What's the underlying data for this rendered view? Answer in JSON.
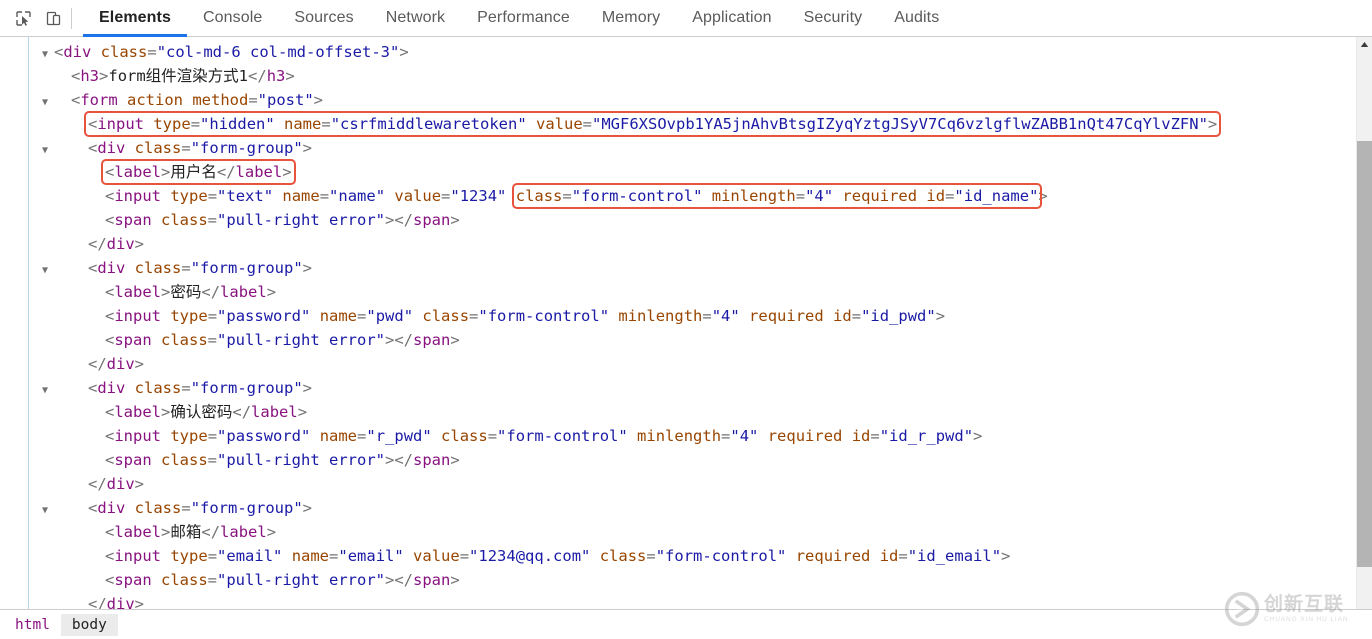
{
  "toolbar": {
    "icons": [
      {
        "name": "inspect-element-icon",
        "label": "Inspect element"
      },
      {
        "name": "device-toolbar-icon",
        "label": "Toggle device toolbar"
      }
    ],
    "tabs": [
      {
        "label": "Elements",
        "active": true
      },
      {
        "label": "Console",
        "active": false
      },
      {
        "label": "Sources",
        "active": false
      },
      {
        "label": "Network",
        "active": false
      },
      {
        "label": "Performance",
        "active": false
      },
      {
        "label": "Memory",
        "active": false
      },
      {
        "label": "Application",
        "active": false
      },
      {
        "label": "Security",
        "active": false
      },
      {
        "label": "Audits",
        "active": false
      }
    ],
    "accent_color": "#1a73e8"
  },
  "code": {
    "highlight_color": "#e8533b",
    "lines": [
      {
        "id": "line-div-col-md",
        "arrow": "▼",
        "indent": 0,
        "tokens": [
          {
            "t": "punc",
            "s": "<"
          },
          {
            "t": "tag",
            "s": "div"
          },
          {
            "t": "attr",
            "s": " class"
          },
          {
            "t": "punc",
            "s": "="
          },
          {
            "t": "val",
            "s": "\"col-md-6 col-md-offset-3\""
          },
          {
            "t": "punc",
            "s": ">"
          }
        ]
      },
      {
        "id": "line-h3",
        "arrow": "",
        "indent": 1,
        "tokens": [
          {
            "t": "punc",
            "s": "<"
          },
          {
            "t": "tag",
            "s": "h3"
          },
          {
            "t": "punc",
            "s": ">"
          },
          {
            "t": "text",
            "s": "form组件渲染方式1"
          },
          {
            "t": "punc",
            "s": "</"
          },
          {
            "t": "tag",
            "s": "h3"
          },
          {
            "t": "punc",
            "s": ">"
          }
        ]
      },
      {
        "id": "line-form",
        "arrow": "▼",
        "indent": 1,
        "tokens": [
          {
            "t": "punc",
            "s": "<"
          },
          {
            "t": "tag",
            "s": "form"
          },
          {
            "t": "attr",
            "s": " action"
          },
          {
            "t": "attr",
            "s": " method"
          },
          {
            "t": "punc",
            "s": "="
          },
          {
            "t": "val",
            "s": "\"post\""
          },
          {
            "t": "punc",
            "s": ">"
          }
        ]
      },
      {
        "id": "line-input-csrf",
        "arrow": "",
        "indent": 2,
        "highlight": true,
        "tokens": [
          {
            "t": "punc",
            "s": "<"
          },
          {
            "t": "tag",
            "s": "input"
          },
          {
            "t": "attr",
            "s": " type"
          },
          {
            "t": "punc",
            "s": "="
          },
          {
            "t": "val",
            "s": "\"hidden\""
          },
          {
            "t": "attr",
            "s": " name"
          },
          {
            "t": "punc",
            "s": "="
          },
          {
            "t": "val",
            "s": "\"csrfmiddlewaretoken\""
          },
          {
            "t": "attr",
            "s": " value"
          },
          {
            "t": "punc",
            "s": "="
          },
          {
            "t": "val",
            "s": "\"MGF6XSOvpb1YA5jnAhvBtsgIZyqYztgJSyV7Cq6vzlgflwZABB1nQt47CqYlvZFN\""
          },
          {
            "t": "punc",
            "s": ">"
          }
        ]
      },
      {
        "id": "line-div-form-group-1",
        "arrow": "▼",
        "indent": 2,
        "tokens": [
          {
            "t": "punc",
            "s": "<"
          },
          {
            "t": "tag",
            "s": "div"
          },
          {
            "t": "attr",
            "s": " class"
          },
          {
            "t": "punc",
            "s": "="
          },
          {
            "t": "val",
            "s": "\"form-group\""
          },
          {
            "t": "punc",
            "s": ">"
          }
        ]
      },
      {
        "id": "line-label-username",
        "arrow": "",
        "indent": 3,
        "highlight": true,
        "tokens": [
          {
            "t": "punc",
            "s": "<"
          },
          {
            "t": "tag",
            "s": "label"
          },
          {
            "t": "punc",
            "s": ">"
          },
          {
            "t": "text",
            "s": "用户名"
          },
          {
            "t": "punc",
            "s": "</"
          },
          {
            "t": "tag",
            "s": "label"
          },
          {
            "t": "punc",
            "s": ">"
          }
        ]
      },
      {
        "id": "line-input-name",
        "arrow": "",
        "indent": 3,
        "split_highlight": true,
        "tokens": [
          {
            "t": "punc",
            "s": "<"
          },
          {
            "t": "tag",
            "s": "input"
          },
          {
            "t": "attr",
            "s": " type"
          },
          {
            "t": "punc",
            "s": "="
          },
          {
            "t": "val",
            "s": "\"text\""
          },
          {
            "t": "attr",
            "s": " name"
          },
          {
            "t": "punc",
            "s": "="
          },
          {
            "t": "val",
            "s": "\"name\""
          },
          {
            "t": "attr",
            "s": " value"
          },
          {
            "t": "punc",
            "s": "="
          },
          {
            "t": "val",
            "s": "\"1234\""
          }
        ],
        "tokens_hl": [
          {
            "t": "attr",
            "s": "class"
          },
          {
            "t": "punc",
            "s": "="
          },
          {
            "t": "val",
            "s": "\"form-control\""
          },
          {
            "t": "attr",
            "s": " minlength"
          },
          {
            "t": "punc",
            "s": "="
          },
          {
            "t": "val",
            "s": "\"4\""
          },
          {
            "t": "attr",
            "s": " required"
          },
          {
            "t": "attr",
            "s": " id"
          },
          {
            "t": "punc",
            "s": "="
          },
          {
            "t": "val",
            "s": "\"id_name\""
          }
        ],
        "tokens_after": [
          {
            "t": "punc",
            "s": ">"
          }
        ]
      },
      {
        "id": "line-span-error-1",
        "arrow": "",
        "indent": 3,
        "tokens": [
          {
            "t": "punc",
            "s": "<"
          },
          {
            "t": "tag",
            "s": "span"
          },
          {
            "t": "attr",
            "s": " class"
          },
          {
            "t": "punc",
            "s": "="
          },
          {
            "t": "val",
            "s": "\"pull-right error\""
          },
          {
            "t": "punc",
            "s": "></"
          },
          {
            "t": "tag",
            "s": "span"
          },
          {
            "t": "punc",
            "s": ">"
          }
        ]
      },
      {
        "id": "line-close-div-1",
        "arrow": "",
        "indent": 2,
        "tokens": [
          {
            "t": "punc",
            "s": "</"
          },
          {
            "t": "tag",
            "s": "div"
          },
          {
            "t": "punc",
            "s": ">"
          }
        ]
      },
      {
        "id": "line-div-form-group-2",
        "arrow": "▼",
        "indent": 2,
        "tokens": [
          {
            "t": "punc",
            "s": "<"
          },
          {
            "t": "tag",
            "s": "div"
          },
          {
            "t": "attr",
            "s": " class"
          },
          {
            "t": "punc",
            "s": "="
          },
          {
            "t": "val",
            "s": "\"form-group\""
          },
          {
            "t": "punc",
            "s": ">"
          }
        ]
      },
      {
        "id": "line-label-password",
        "arrow": "",
        "indent": 3,
        "tokens": [
          {
            "t": "punc",
            "s": "<"
          },
          {
            "t": "tag",
            "s": "label"
          },
          {
            "t": "punc",
            "s": ">"
          },
          {
            "t": "text",
            "s": "密码"
          },
          {
            "t": "punc",
            "s": "</"
          },
          {
            "t": "tag",
            "s": "label"
          },
          {
            "t": "punc",
            "s": ">"
          }
        ]
      },
      {
        "id": "line-input-pwd",
        "arrow": "",
        "indent": 3,
        "tokens": [
          {
            "t": "punc",
            "s": "<"
          },
          {
            "t": "tag",
            "s": "input"
          },
          {
            "t": "attr",
            "s": " type"
          },
          {
            "t": "punc",
            "s": "="
          },
          {
            "t": "val",
            "s": "\"password\""
          },
          {
            "t": "attr",
            "s": " name"
          },
          {
            "t": "punc",
            "s": "="
          },
          {
            "t": "val",
            "s": "\"pwd\""
          },
          {
            "t": "attr",
            "s": " class"
          },
          {
            "t": "punc",
            "s": "="
          },
          {
            "t": "val",
            "s": "\"form-control\""
          },
          {
            "t": "attr",
            "s": " minlength"
          },
          {
            "t": "punc",
            "s": "="
          },
          {
            "t": "val",
            "s": "\"4\""
          },
          {
            "t": "attr",
            "s": " required"
          },
          {
            "t": "attr",
            "s": " id"
          },
          {
            "t": "punc",
            "s": "="
          },
          {
            "t": "val",
            "s": "\"id_pwd\""
          },
          {
            "t": "punc",
            "s": ">"
          }
        ]
      },
      {
        "id": "line-span-error-2",
        "arrow": "",
        "indent": 3,
        "tokens": [
          {
            "t": "punc",
            "s": "<"
          },
          {
            "t": "tag",
            "s": "span"
          },
          {
            "t": "attr",
            "s": " class"
          },
          {
            "t": "punc",
            "s": "="
          },
          {
            "t": "val",
            "s": "\"pull-right error\""
          },
          {
            "t": "punc",
            "s": "></"
          },
          {
            "t": "tag",
            "s": "span"
          },
          {
            "t": "punc",
            "s": ">"
          }
        ]
      },
      {
        "id": "line-close-div-2",
        "arrow": "",
        "indent": 2,
        "tokens": [
          {
            "t": "punc",
            "s": "</"
          },
          {
            "t": "tag",
            "s": "div"
          },
          {
            "t": "punc",
            "s": ">"
          }
        ]
      },
      {
        "id": "line-div-form-group-3",
        "arrow": "▼",
        "indent": 2,
        "tokens": [
          {
            "t": "punc",
            "s": "<"
          },
          {
            "t": "tag",
            "s": "div"
          },
          {
            "t": "attr",
            "s": " class"
          },
          {
            "t": "punc",
            "s": "="
          },
          {
            "t": "val",
            "s": "\"form-group\""
          },
          {
            "t": "punc",
            "s": ">"
          }
        ]
      },
      {
        "id": "line-label-confirm-password",
        "arrow": "",
        "indent": 3,
        "tokens": [
          {
            "t": "punc",
            "s": "<"
          },
          {
            "t": "tag",
            "s": "label"
          },
          {
            "t": "punc",
            "s": ">"
          },
          {
            "t": "text",
            "s": "确认密码"
          },
          {
            "t": "punc",
            "s": "</"
          },
          {
            "t": "tag",
            "s": "label"
          },
          {
            "t": "punc",
            "s": ">"
          }
        ]
      },
      {
        "id": "line-input-r-pwd",
        "arrow": "",
        "indent": 3,
        "tokens": [
          {
            "t": "punc",
            "s": "<"
          },
          {
            "t": "tag",
            "s": "input"
          },
          {
            "t": "attr",
            "s": " type"
          },
          {
            "t": "punc",
            "s": "="
          },
          {
            "t": "val",
            "s": "\"password\""
          },
          {
            "t": "attr",
            "s": " name"
          },
          {
            "t": "punc",
            "s": "="
          },
          {
            "t": "val",
            "s": "\"r_pwd\""
          },
          {
            "t": "attr",
            "s": " class"
          },
          {
            "t": "punc",
            "s": "="
          },
          {
            "t": "val",
            "s": "\"form-control\""
          },
          {
            "t": "attr",
            "s": " minlength"
          },
          {
            "t": "punc",
            "s": "="
          },
          {
            "t": "val",
            "s": "\"4\""
          },
          {
            "t": "attr",
            "s": " required"
          },
          {
            "t": "attr",
            "s": " id"
          },
          {
            "t": "punc",
            "s": "="
          },
          {
            "t": "val",
            "s": "\"id_r_pwd\""
          },
          {
            "t": "punc",
            "s": ">"
          }
        ]
      },
      {
        "id": "line-span-error-3",
        "arrow": "",
        "indent": 3,
        "tokens": [
          {
            "t": "punc",
            "s": "<"
          },
          {
            "t": "tag",
            "s": "span"
          },
          {
            "t": "attr",
            "s": " class"
          },
          {
            "t": "punc",
            "s": "="
          },
          {
            "t": "val",
            "s": "\"pull-right error\""
          },
          {
            "t": "punc",
            "s": "></"
          },
          {
            "t": "tag",
            "s": "span"
          },
          {
            "t": "punc",
            "s": ">"
          }
        ]
      },
      {
        "id": "line-close-div-3",
        "arrow": "",
        "indent": 2,
        "tokens": [
          {
            "t": "punc",
            "s": "</"
          },
          {
            "t": "tag",
            "s": "div"
          },
          {
            "t": "punc",
            "s": ">"
          }
        ]
      },
      {
        "id": "line-div-form-group-4",
        "arrow": "▼",
        "indent": 2,
        "tokens": [
          {
            "t": "punc",
            "s": "<"
          },
          {
            "t": "tag",
            "s": "div"
          },
          {
            "t": "attr",
            "s": " class"
          },
          {
            "t": "punc",
            "s": "="
          },
          {
            "t": "val",
            "s": "\"form-group\""
          },
          {
            "t": "punc",
            "s": ">"
          }
        ]
      },
      {
        "id": "line-label-email",
        "arrow": "",
        "indent": 3,
        "tokens": [
          {
            "t": "punc",
            "s": "<"
          },
          {
            "t": "tag",
            "s": "label"
          },
          {
            "t": "punc",
            "s": ">"
          },
          {
            "t": "text",
            "s": "邮箱"
          },
          {
            "t": "punc",
            "s": "</"
          },
          {
            "t": "tag",
            "s": "label"
          },
          {
            "t": "punc",
            "s": ">"
          }
        ]
      },
      {
        "id": "line-input-email",
        "arrow": "",
        "indent": 3,
        "tokens": [
          {
            "t": "punc",
            "s": "<"
          },
          {
            "t": "tag",
            "s": "input"
          },
          {
            "t": "attr",
            "s": " type"
          },
          {
            "t": "punc",
            "s": "="
          },
          {
            "t": "val",
            "s": "\"email\""
          },
          {
            "t": "attr",
            "s": " name"
          },
          {
            "t": "punc",
            "s": "="
          },
          {
            "t": "val",
            "s": "\"email\""
          },
          {
            "t": "attr",
            "s": " value"
          },
          {
            "t": "punc",
            "s": "="
          },
          {
            "t": "val",
            "s": "\"1234@qq.com\""
          },
          {
            "t": "attr",
            "s": " class"
          },
          {
            "t": "punc",
            "s": "="
          },
          {
            "t": "val",
            "s": "\"form-control\""
          },
          {
            "t": "attr",
            "s": " required"
          },
          {
            "t": "attr",
            "s": " id"
          },
          {
            "t": "punc",
            "s": "="
          },
          {
            "t": "val",
            "s": "\"id_email\""
          },
          {
            "t": "punc",
            "s": ">"
          }
        ]
      },
      {
        "id": "line-span-error-4",
        "arrow": "",
        "indent": 3,
        "tokens": [
          {
            "t": "punc",
            "s": "<"
          },
          {
            "t": "tag",
            "s": "span"
          },
          {
            "t": "attr",
            "s": " class"
          },
          {
            "t": "punc",
            "s": "="
          },
          {
            "t": "val",
            "s": "\"pull-right error\""
          },
          {
            "t": "punc",
            "s": "></"
          },
          {
            "t": "tag",
            "s": "span"
          },
          {
            "t": "punc",
            "s": ">"
          }
        ]
      },
      {
        "id": "line-close-div-4",
        "arrow": "",
        "indent": 2,
        "tokens": [
          {
            "t": "punc",
            "s": "</"
          },
          {
            "t": "tag",
            "s": "div"
          },
          {
            "t": "punc",
            "s": ">"
          }
        ]
      }
    ]
  },
  "breadcrumb": {
    "items": [
      {
        "label": "html",
        "selected": false
      },
      {
        "label": "body",
        "selected": true
      }
    ]
  },
  "watermark": {
    "cn": "创新互联",
    "en": "CHUANG XIN HU LIAN"
  }
}
